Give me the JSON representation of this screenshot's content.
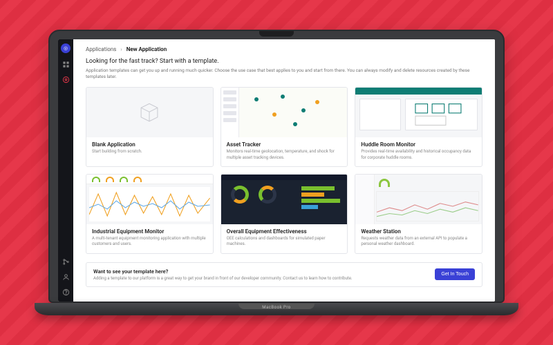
{
  "laptop_label": "MacBook Pro",
  "breadcrumb": {
    "parent": "Applications",
    "current": "New Application"
  },
  "header": {
    "title": "Looking for the fast track? Start with a template.",
    "subtitle": "Application templates can get you up and running much quicker. Choose the use case that best applies to you and start from there. You can always modify and delete resources created by these templates later."
  },
  "templates": [
    {
      "title": "Blank Application",
      "desc": "Start building from scratch."
    },
    {
      "title": "Asset Tracker",
      "desc": "Monitors real-time geolocation, temperature, and shock for multiple asset tracking devices."
    },
    {
      "title": "Huddle Room Monitor",
      "desc": "Provides real-time availability and historical occupancy data for corporate huddle rooms."
    },
    {
      "title": "Industrial Equipment Monitor",
      "desc": "A multi-tenant equipment monitoring application with multiple customers and users."
    },
    {
      "title": "Overall Equipment Effectiveness",
      "desc": "OEE calculations and dashboards for simulated paper machines."
    },
    {
      "title": "Weather Station",
      "desc": "Requests weather data from an external API to populate a personal weather dashboard."
    }
  ],
  "footer": {
    "title": "Want to see your template here?",
    "subtitle": "Adding a template to our platform is a great way to get your brand in front of our developer community. Contact us to learn how to contribute.",
    "button": "Get In Touch"
  },
  "colors": {
    "accent": "#3a41d6",
    "bg_red": "#e6374a"
  }
}
